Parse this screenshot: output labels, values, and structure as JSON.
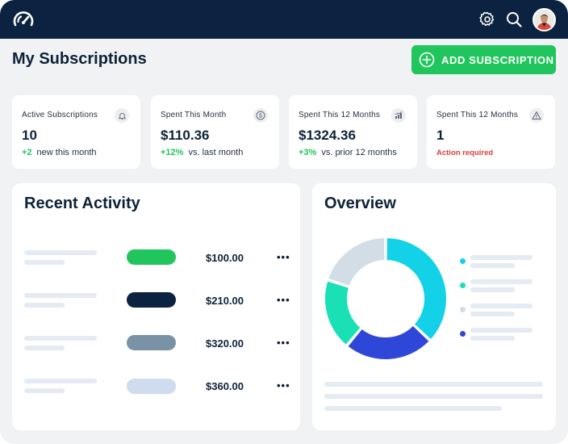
{
  "header": {
    "logo_icon": "speedometer-icon",
    "settings_icon": "gear-icon",
    "search_icon": "search-icon",
    "avatar": "user-avatar"
  },
  "page": {
    "title": "My Subscriptions",
    "add_button_label": "ADD SUBSCRIPTION",
    "add_button_icon": "plus-circle-icon"
  },
  "colors": {
    "navy": "#0b2240",
    "green": "#21c55d",
    "red": "#e03b3b",
    "cyan": "#13d2e8",
    "teal": "#19e0b5",
    "blue": "#2f47d8",
    "gray": "#d2dde6"
  },
  "stats": [
    {
      "label": "Active Subscriptions",
      "value": "10",
      "change": "+2",
      "note": "new this month",
      "icon": "bell-icon"
    },
    {
      "label": "Spent This Month",
      "value": "$110.36",
      "change": "+12%",
      "note": "vs. last month",
      "icon": "dollar-icon"
    },
    {
      "label": "Spent This 12 Months",
      "value": "$1324.36",
      "change": "+3%",
      "note": "vs. prior 12 months",
      "icon": "bar-chart-icon"
    },
    {
      "label": "Spent This 12 Months",
      "value": "1",
      "warning": "Action required",
      "icon": "warning-icon"
    }
  ],
  "recent_activity": {
    "title": "Recent Activity",
    "rows": [
      {
        "amount": "$100.00",
        "color": "#21c55d"
      },
      {
        "amount": "$210.00",
        "color": "#0b2240"
      },
      {
        "amount": "$320.00",
        "color": "#7a92a6"
      },
      {
        "amount": "$360.00",
        "color": "#cfdcf0"
      }
    ],
    "more_label": "•••"
  },
  "overview": {
    "title": "Overview",
    "segments": [
      {
        "value": 37,
        "color": "#13d2e8"
      },
      {
        "value": 24,
        "color": "#2f47d8"
      },
      {
        "value": 19,
        "color": "#19e0b5"
      },
      {
        "value": 20,
        "color": "#d2dde6"
      }
    ],
    "legend_colors": [
      "#13d2e8",
      "#19e0b5",
      "#d2dde6",
      "#2f47d8"
    ]
  }
}
